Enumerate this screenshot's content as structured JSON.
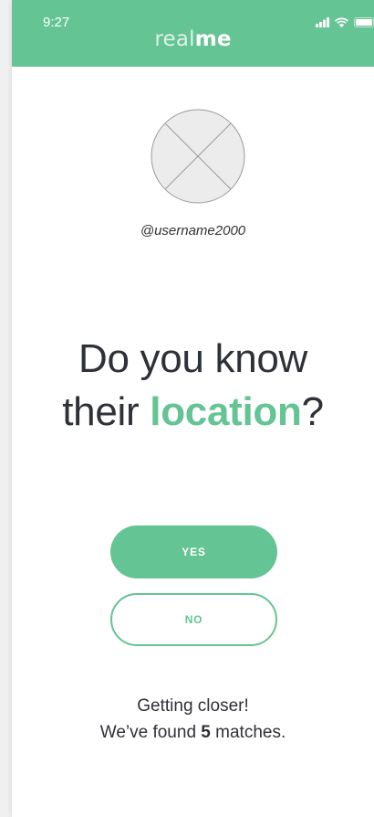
{
  "status_bar": {
    "time": "9:27",
    "icons": [
      "cellular-signal-icon",
      "wifi-icon",
      "battery-icon"
    ]
  },
  "brand": {
    "part1": "real",
    "part2": "me"
  },
  "profile": {
    "avatar_icon": "avatar-placeholder-icon",
    "username": "@username2000"
  },
  "question": {
    "line1": "Do you know",
    "line2_prefix": "their ",
    "highlight": "location",
    "line2_suffix": "?"
  },
  "buttons": {
    "yes_label": "YES",
    "no_label": "NO"
  },
  "footer": {
    "line1": "Getting closer!",
    "line2_prefix": "We’ve found ",
    "match_count": "5",
    "line2_suffix": " matches."
  },
  "colors": {
    "accent": "#65c494",
    "text": "#2f3138",
    "white": "#ffffff"
  }
}
